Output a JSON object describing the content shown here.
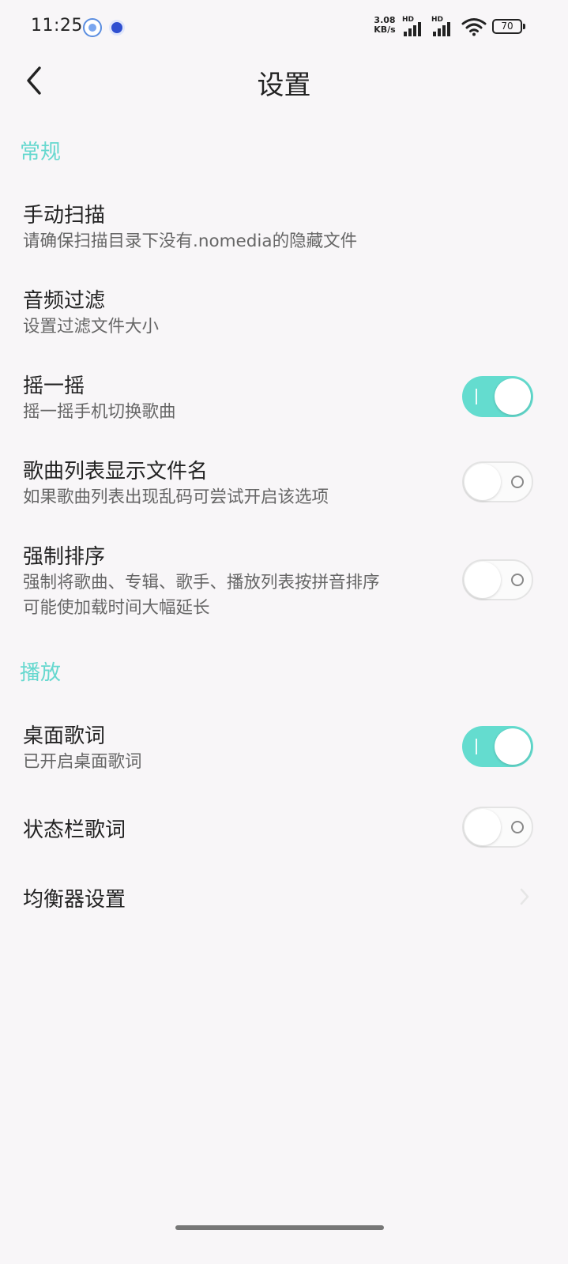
{
  "status_bar": {
    "time": "11:25",
    "net_speed_value": "3.08",
    "net_speed_unit": "KB/s",
    "sim1_label": "HD",
    "sim2_label": "HD",
    "battery": "70"
  },
  "header": {
    "title": "设置"
  },
  "sections": {
    "general": {
      "label": "常规",
      "items": {
        "manual_scan": {
          "title": "手动扫描",
          "subtitle": "请确保扫描目录下没有.nomedia的隐藏文件"
        },
        "audio_filter": {
          "title": "音频过滤",
          "subtitle": "设置过滤文件大小"
        },
        "shake": {
          "title": "摇一摇",
          "subtitle": "摇一摇手机切换歌曲",
          "enabled": true
        },
        "show_filename": {
          "title": "歌曲列表显示文件名",
          "subtitle": "如果歌曲列表出现乱码可尝试开启该选项",
          "enabled": false
        },
        "force_sort": {
          "title": "强制排序",
          "subtitle_line1": "强制将歌曲、专辑、歌手、播放列表按拼音排序",
          "subtitle_line2": "可能使加载时间大幅延长",
          "enabled": false
        }
      }
    },
    "playback": {
      "label": "播放",
      "items": {
        "desktop_lyrics": {
          "title": "桌面歌词",
          "subtitle": "已开启桌面歌词",
          "enabled": true
        },
        "statusbar_lyrics": {
          "title": "状态栏歌词",
          "enabled": false
        },
        "equalizer": {
          "title": "均衡器设置"
        }
      }
    }
  },
  "colors": {
    "accent": "#64dccf",
    "section_header": "#66d8cf",
    "background": "#f8f6f8"
  }
}
